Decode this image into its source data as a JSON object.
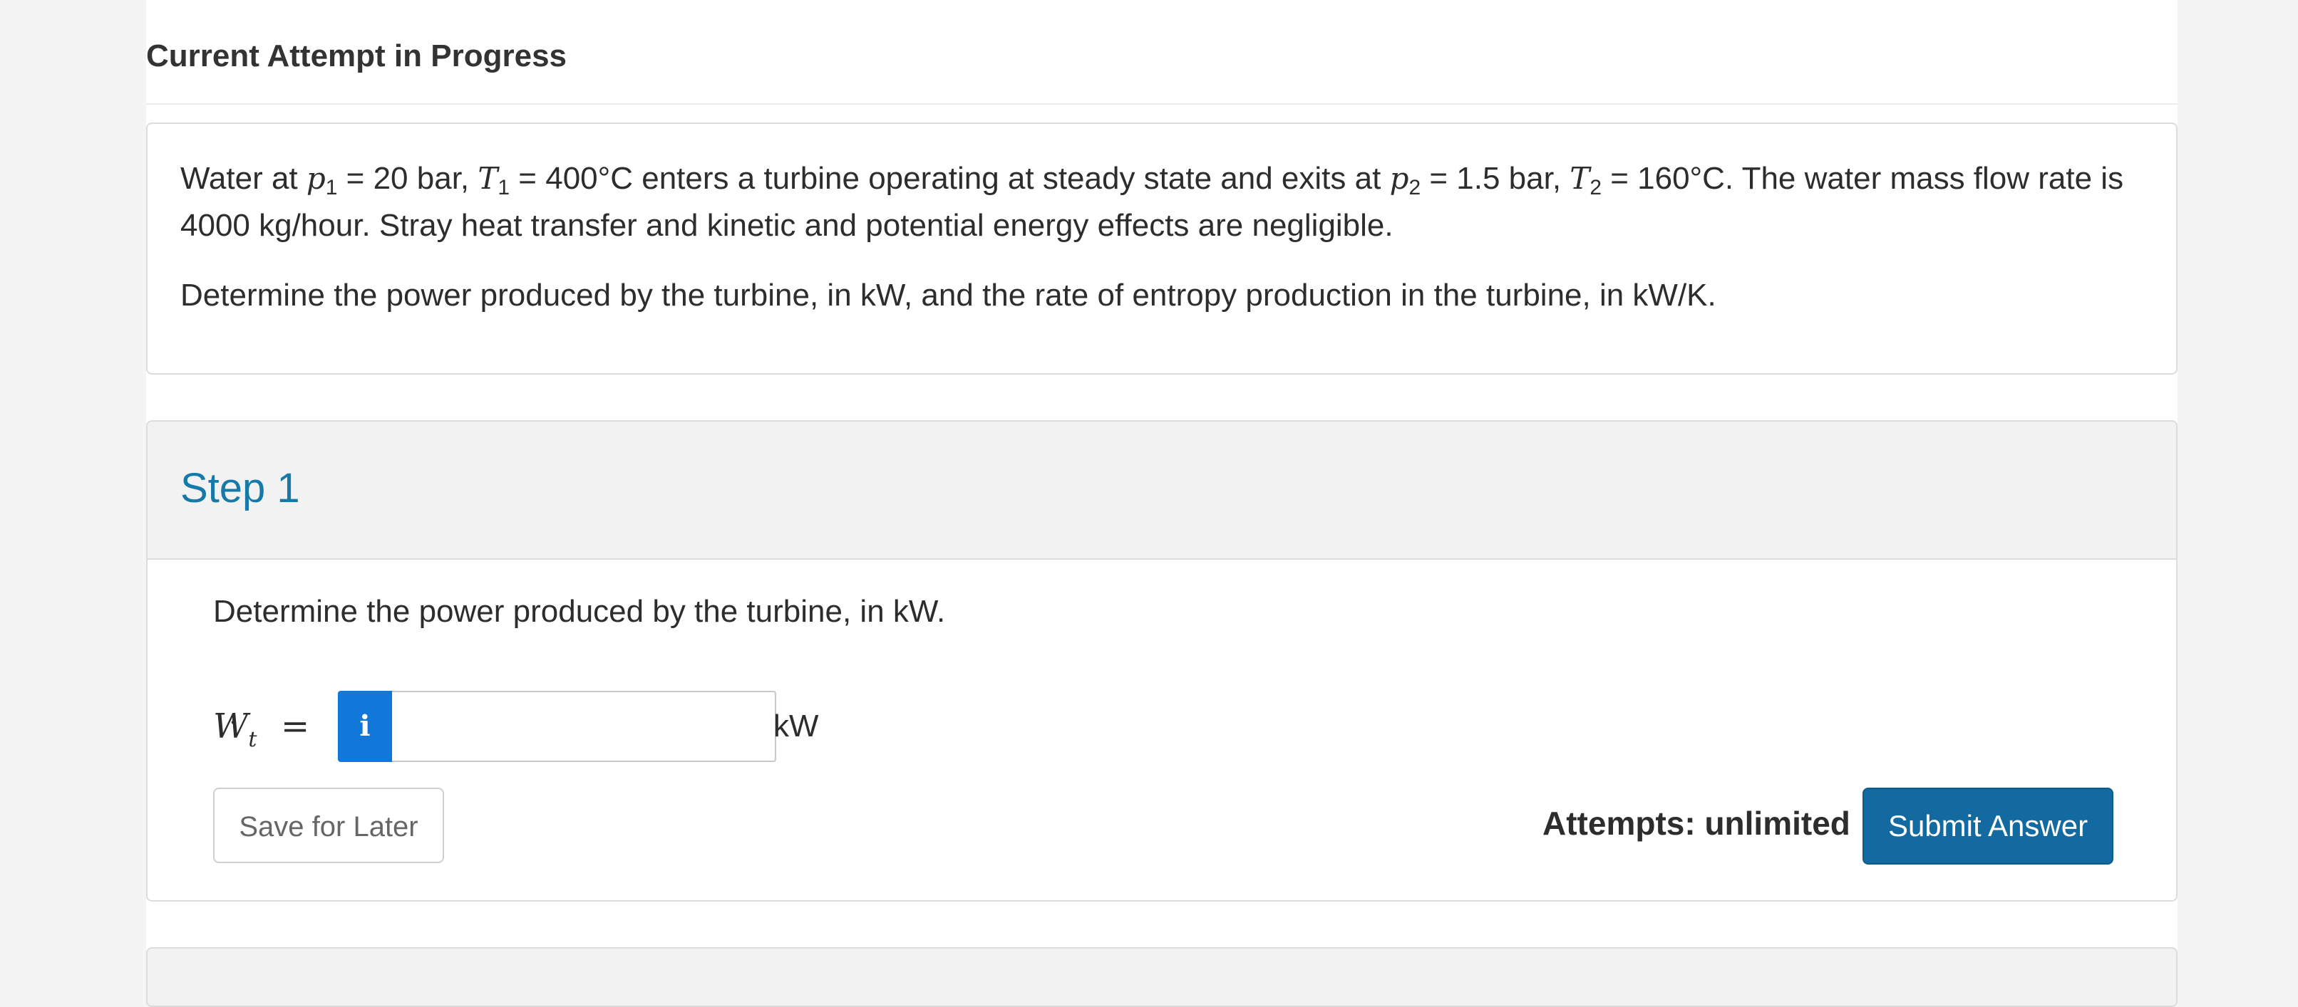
{
  "attempt": {
    "title": "Current Attempt in Progress"
  },
  "question": {
    "p1_a": "Water at ",
    "p1_var1": "p",
    "p1_sub1": "1",
    "p1_b": " = 20 bar, ",
    "p1_var2": "T",
    "p1_sub2": "1",
    "p1_c": " = 400°C enters a turbine operating at steady state and exits at ",
    "p1_var3": "p",
    "p1_sub3": "2",
    "p1_d": " = 1.5 bar, ",
    "p1_var4": "T",
    "p1_sub4": "2",
    "p1_e": " = 160°C.  The water mass flow rate is 4000 kg/hour. Stray heat transfer and kinetic and potential energy effects are negligible.",
    "p2": "Determine the power produced by the turbine, in kW, and the rate of entropy production in the turbine, in kW/K."
  },
  "step": {
    "title": "Step 1",
    "prompt": "Determine the power produced by the turbine, in kW.",
    "variable": "W",
    "variable_sub": "t",
    "equals": "=",
    "info_icon": "i",
    "input_value": "",
    "unit": "kW",
    "save_label": "Save for Later",
    "attempts_label": "Attempts: unlimited",
    "submit_label": "Submit Answer"
  }
}
